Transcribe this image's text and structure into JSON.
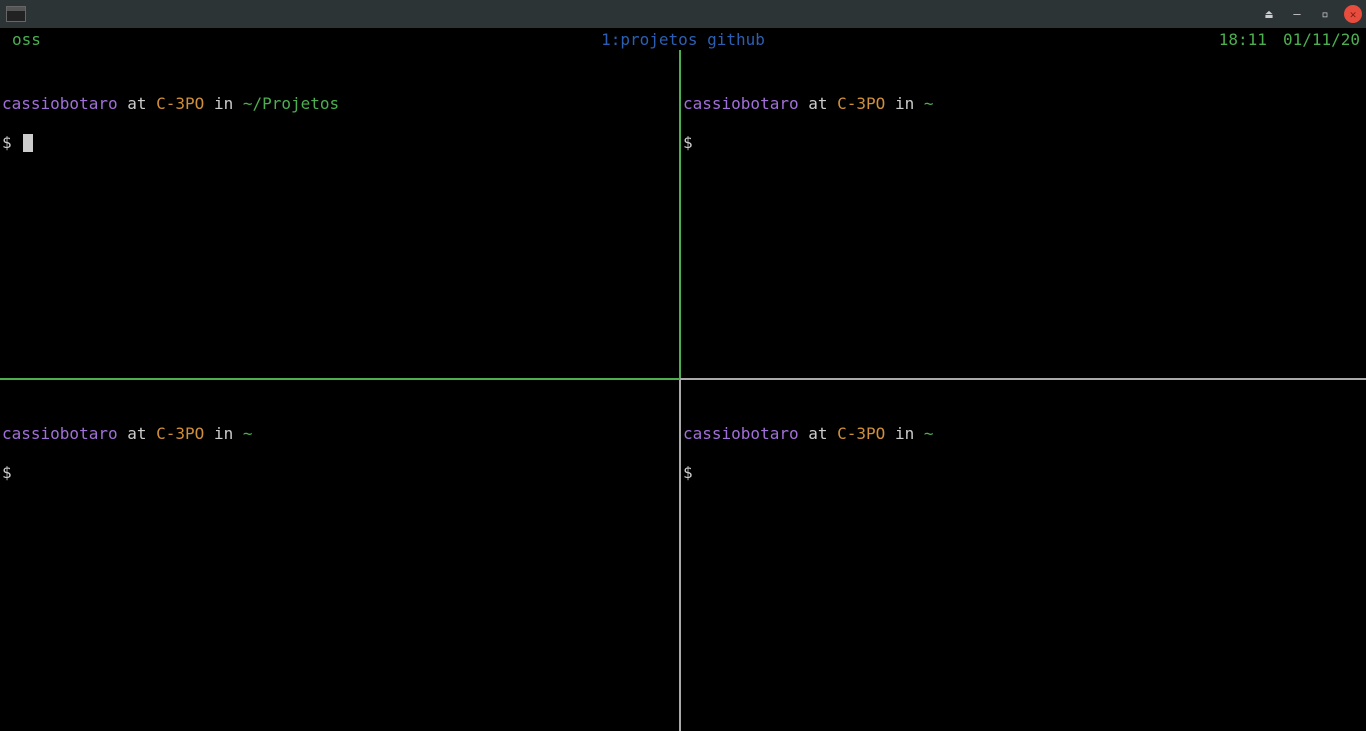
{
  "titlebar": {
    "controls": {
      "eject": "⏏",
      "minimize": "—",
      "maximize": "▫",
      "close": "✕"
    }
  },
  "tmux": {
    "session": "oss",
    "window": "1:projetos github",
    "time": "18:11",
    "date": "01/11/20"
  },
  "panes": {
    "tl": {
      "user": "cassiobotaro",
      "at": "at",
      "host": "C-3PO",
      "in": "in",
      "path": "~/Projetos",
      "prompt": "$",
      "active": true
    },
    "tr": {
      "user": "cassiobotaro",
      "at": "at",
      "host": "C-3PO",
      "in": "in",
      "path": "~",
      "prompt": "$",
      "active": false
    },
    "bl": {
      "user": "cassiobotaro",
      "at": "at",
      "host": "C-3PO",
      "in": "in",
      "path": "~",
      "prompt": "$",
      "active": false
    },
    "br": {
      "user": "cassiobotaro",
      "at": "at",
      "host": "C-3PO",
      "in": "in",
      "path": "~",
      "prompt": "$",
      "active": false
    }
  }
}
